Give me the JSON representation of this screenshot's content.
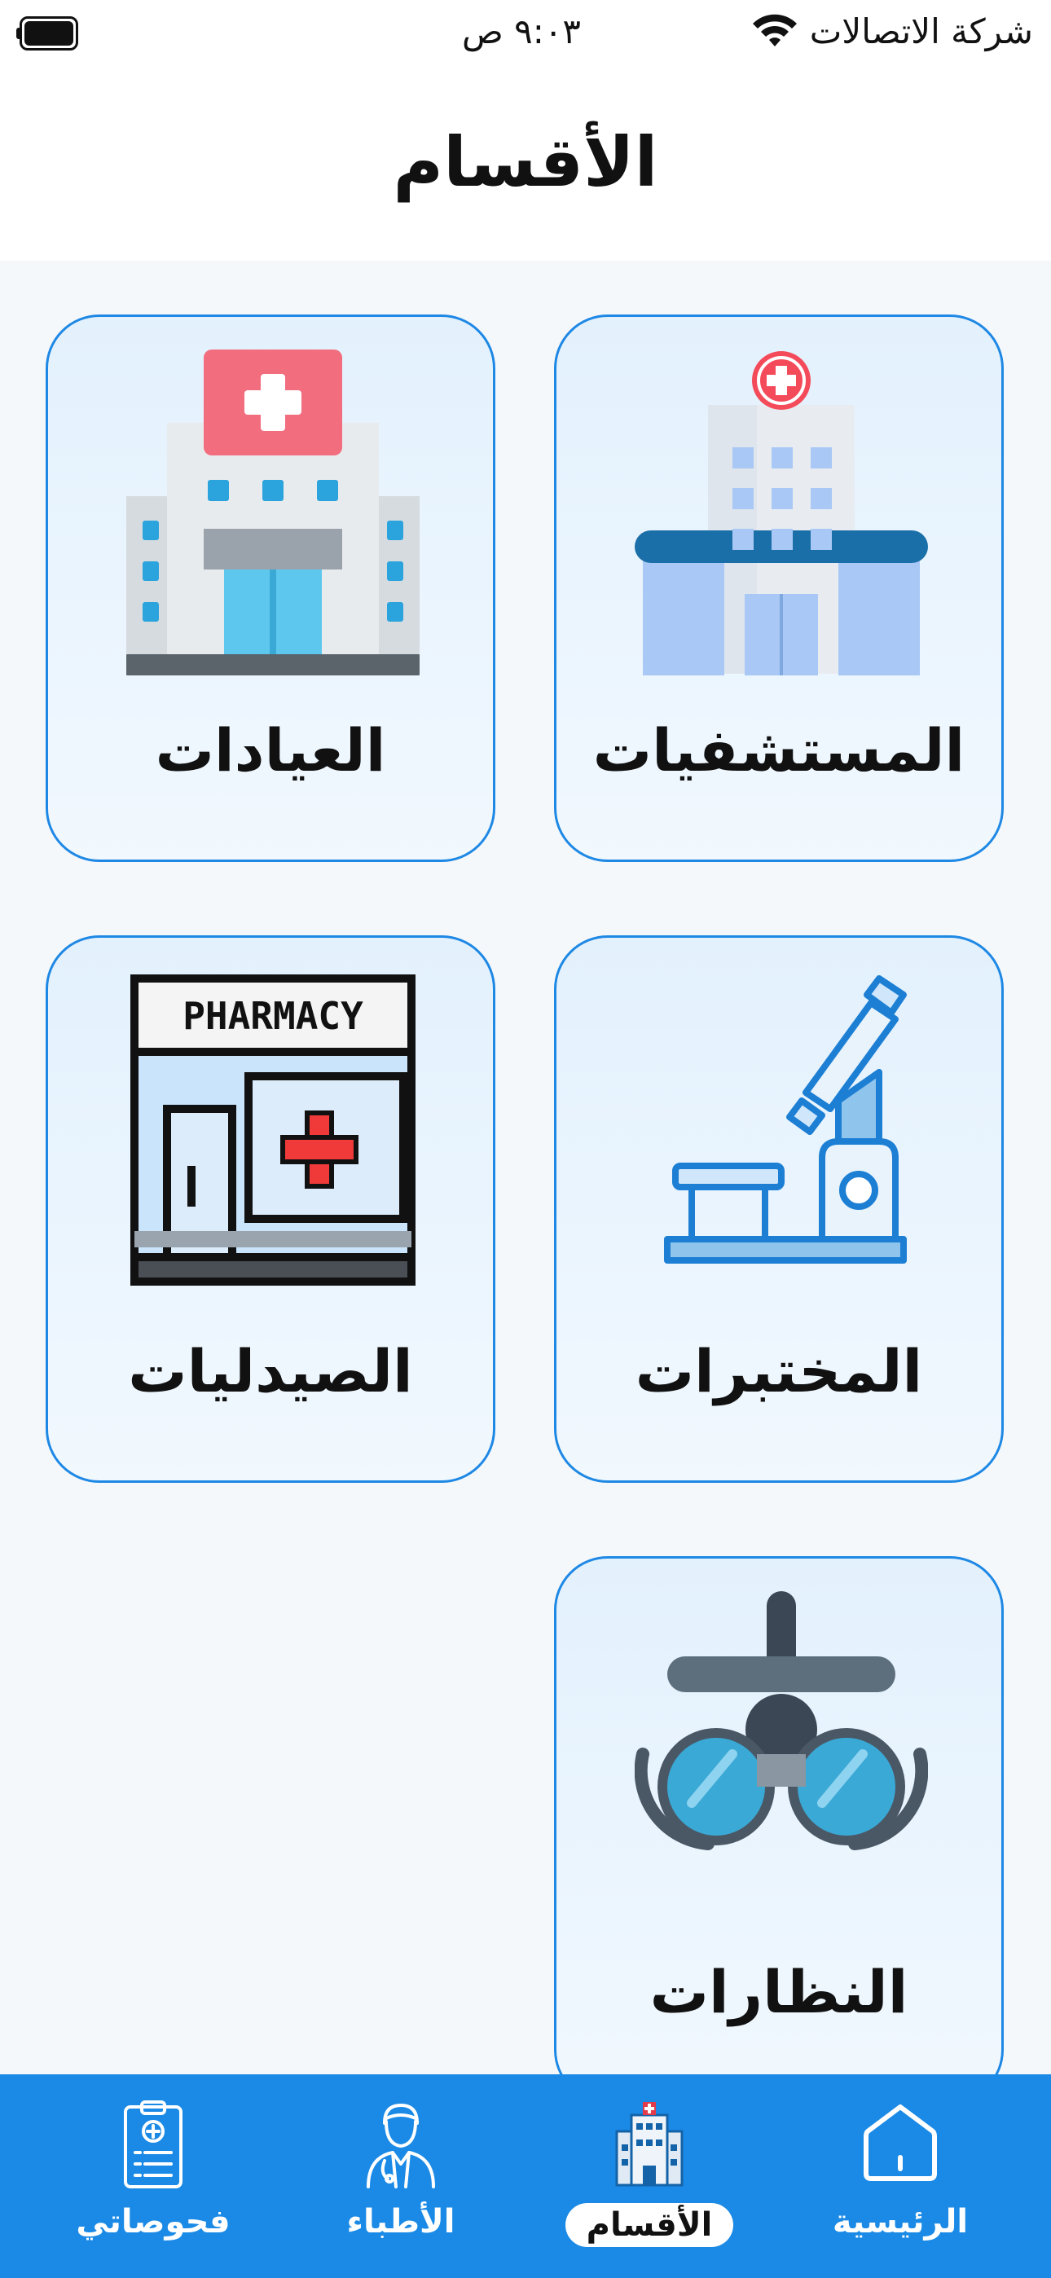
{
  "status_bar": {
    "carrier": "شركة الاتصالات",
    "time": "٩:٠٣ ص"
  },
  "header": {
    "title": "الأقسام"
  },
  "sections": [
    {
      "label": "المستشفيات",
      "icon": "hospital-icon"
    },
    {
      "label": "العيادات",
      "icon": "clinic-building-icon"
    },
    {
      "label": "المختبرات",
      "icon": "microscope-icon"
    },
    {
      "label": "الصيدليات",
      "icon": "pharmacy-icon"
    },
    {
      "label": "النظارات",
      "icon": "eyeglasses-icon"
    }
  ],
  "pharmacy_sign": "PHARMACY",
  "bottom_nav": [
    {
      "label": "الرئيسية",
      "icon": "home-icon"
    },
    {
      "label": "الأقسام",
      "icon": "building-icon",
      "active": true
    },
    {
      "label": "الأطباء",
      "icon": "doctor-icon"
    },
    {
      "label": "فحوصاتي",
      "icon": "clipboard-icon"
    }
  ],
  "colors": {
    "accent": "#1a8ae6",
    "card_border": "#1e88e5"
  }
}
